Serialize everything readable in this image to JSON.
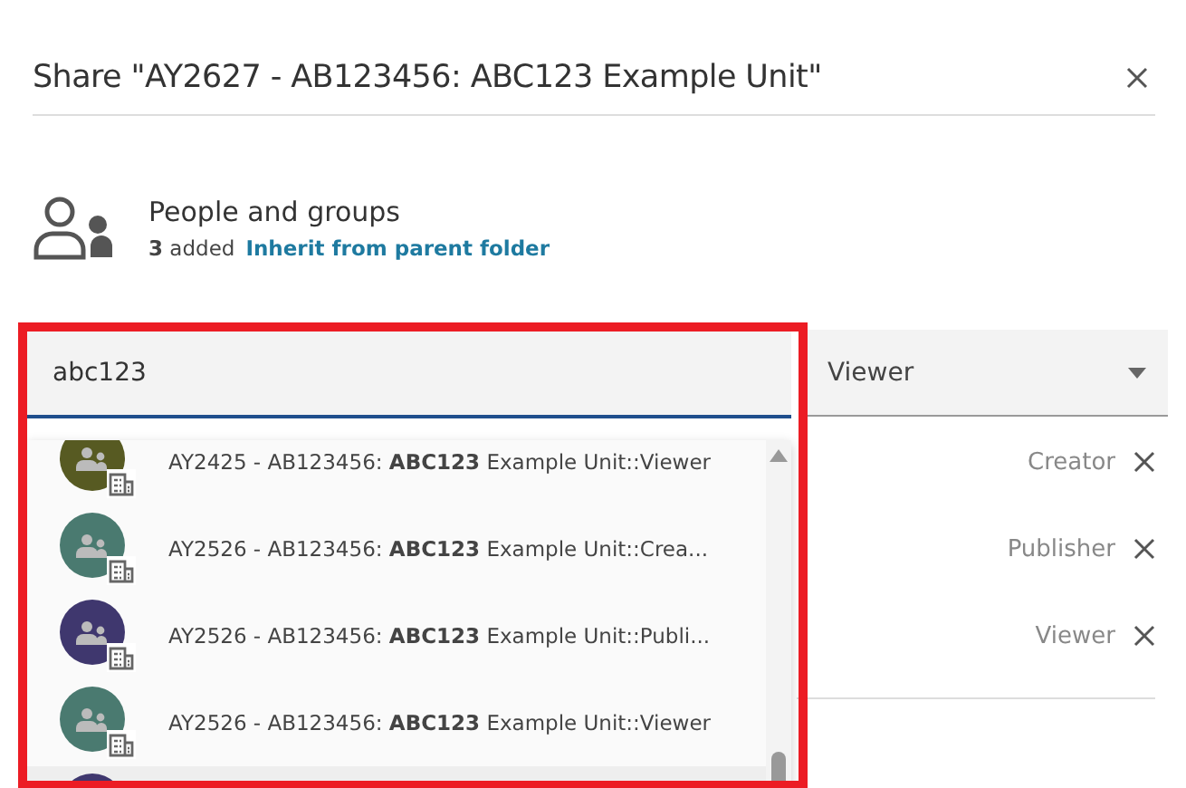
{
  "dialog": {
    "title": "Share \"AY2627 - AB123456: ABC123 Example Unit\""
  },
  "people": {
    "heading": "People and groups",
    "count": "3",
    "count_suffix": "added",
    "inherit_link": "Inherit from parent folder"
  },
  "search": {
    "value": "abc123"
  },
  "role_select": {
    "value": "Viewer"
  },
  "members": [
    {
      "role": "Creator"
    },
    {
      "role": "Publisher"
    },
    {
      "role": "Viewer"
    }
  ],
  "suggestions": [
    {
      "label": "AY2425 - AB123456: **ABC123** Example Unit::Viewer",
      "color": "#575a22",
      "selected": false
    },
    {
      "label": "AY2526 - AB123456: **ABC123** Example Unit::Crea...",
      "color": "#4a7a70",
      "selected": false
    },
    {
      "label": "AY2526 - AB123456: **ABC123** Example Unit::Publi...",
      "color": "#3f376e",
      "selected": false
    },
    {
      "label": "AY2526 - AB123456: **ABC123** Example Unit::Viewer",
      "color": "#4a7a70",
      "selected": false
    },
    {
      "color": "#3f376e",
      "selected": true
    }
  ]
}
